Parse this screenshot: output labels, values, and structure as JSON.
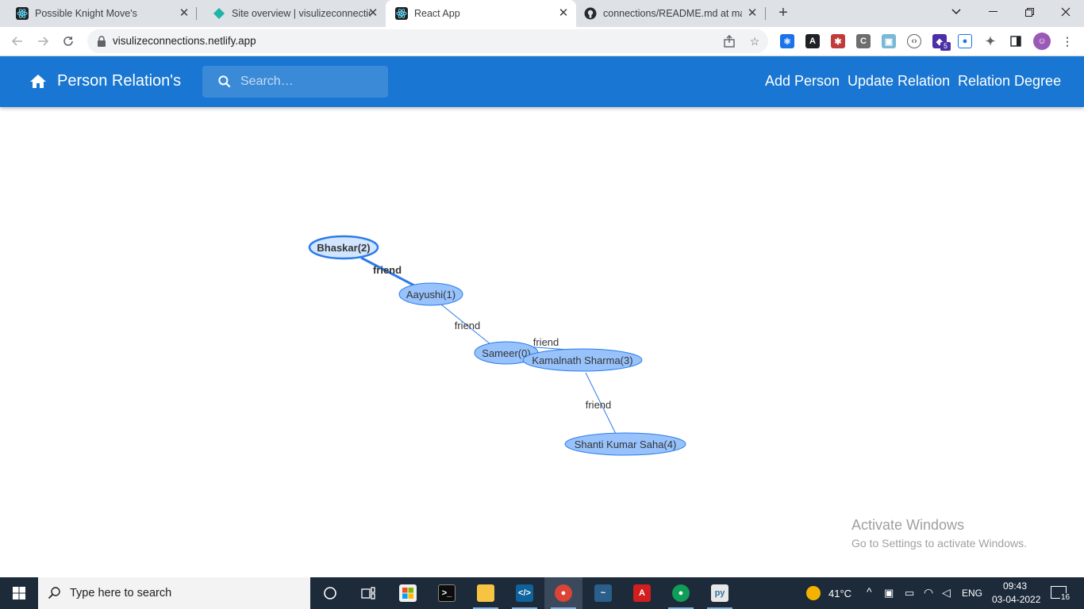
{
  "browser": {
    "tabs": [
      {
        "title": "Possible Knight Move's",
        "icon": "react-icon"
      },
      {
        "title": "Site overview | visulizeconnections",
        "icon": "netlify-icon"
      },
      {
        "title": "React App",
        "icon": "react-icon",
        "active": true
      },
      {
        "title": "connections/README.md at master",
        "icon": "github-icon"
      }
    ],
    "url": "visulizeconnections.netlify.app",
    "extensions_badge": "5"
  },
  "appbar": {
    "title": "Person Relation's",
    "search_placeholder": "Search…",
    "nav": {
      "add_person": "Add Person",
      "update_relation": "Update Relation",
      "relation_degree": "Relation Degree"
    },
    "color": "#1976d2"
  },
  "graph": {
    "nodes": [
      {
        "id": "n2",
        "label": "Bhaskar(2)",
        "selected": true
      },
      {
        "id": "n1",
        "label": "Aayushi(1)"
      },
      {
        "id": "n0",
        "label": "Sameer(0)"
      },
      {
        "id": "n3",
        "label": "Kamalnath Sharma(3)"
      },
      {
        "id": "n4",
        "label": "Shanti Kumar Saha(4)"
      }
    ],
    "edges": [
      {
        "from": "n2",
        "to": "n1",
        "label": "friend",
        "selected": true
      },
      {
        "from": "n1",
        "to": "n0",
        "label": "friend"
      },
      {
        "from": "n0",
        "to": "n3",
        "label": "friend"
      },
      {
        "from": "n3",
        "to": "n4",
        "label": "friend"
      }
    ],
    "node_fill": "#97c2fc",
    "node_border": "#2b7ce9"
  },
  "watermark": {
    "line1": "Activate Windows",
    "line2": "Go to Settings to activate Windows."
  },
  "taskbar": {
    "search_text": "Type here to search",
    "weather": "41°C",
    "language": "ENG",
    "time": "09:43",
    "date": "03-04-2022",
    "notifications": "16"
  }
}
